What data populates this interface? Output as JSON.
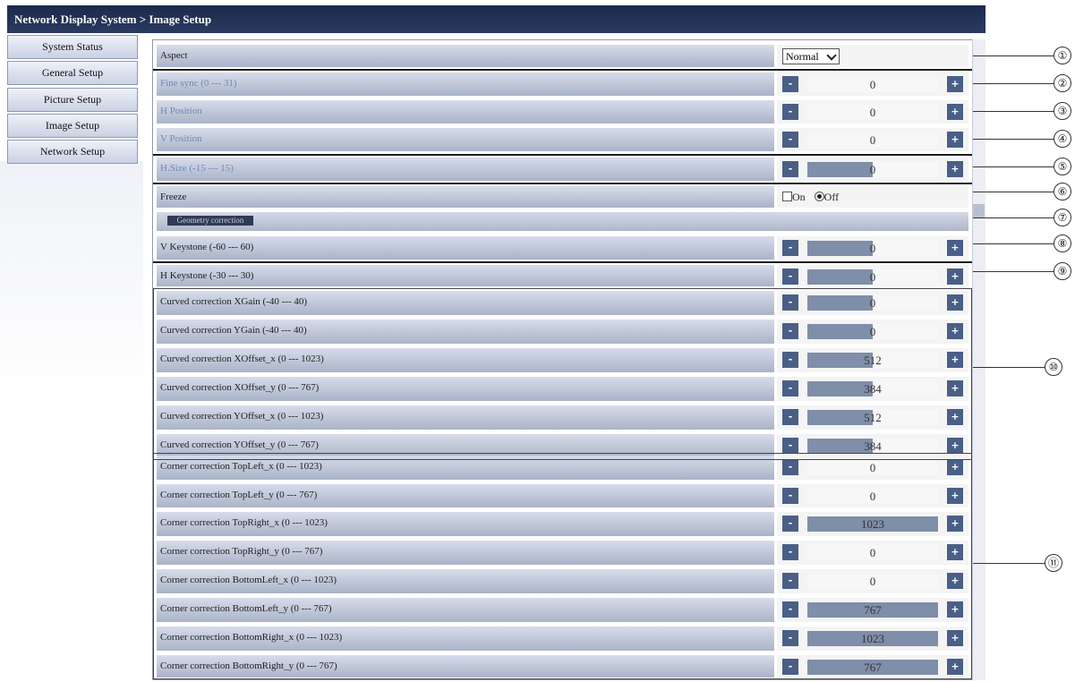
{
  "header": {
    "title": "Network Display System > Image Setup"
  },
  "sidebar": {
    "items": [
      {
        "label": "System Status"
      },
      {
        "label": "General Setup"
      },
      {
        "label": "Picture Setup"
      },
      {
        "label": "Image Setup"
      },
      {
        "label": "Network Setup"
      }
    ]
  },
  "settings": {
    "aspect": {
      "label": "Aspect",
      "value": "Normal"
    },
    "fine_sync": {
      "label": "Fine sync (0 --- 31)",
      "value": "0"
    },
    "h_position": {
      "label": "H Position",
      "value": "0"
    },
    "v_position": {
      "label": "V Position",
      "value": "0"
    },
    "h_size": {
      "label": "H.Size (-15 --- 15)",
      "value": "0",
      "level": 0.5
    },
    "freeze": {
      "label": "Freeze",
      "on_label": "On",
      "off_label": "Off",
      "selected": "Off"
    },
    "section_title": "Geometry correction",
    "v_keystone": {
      "label": "V Keystone (-60 --- 60)",
      "value": "0",
      "level": 0.5
    },
    "h_keystone": {
      "label": "H Keystone (-30 --- 30)",
      "value": "0",
      "level": 0.5
    },
    "curved": [
      {
        "label": "Curved correction XGain (-40 --- 40)",
        "value": "0",
        "level": 0.5
      },
      {
        "label": "Curved correction YGain (-40 --- 40)",
        "value": "0",
        "level": 0.5
      },
      {
        "label": "Curved correction XOffset_x (0 --- 1023)",
        "value": "512",
        "level": 0.5
      },
      {
        "label": "Curved correction XOffset_y (0 --- 767)",
        "value": "384",
        "level": 0.5
      },
      {
        "label": "Curved correction YOffset_x (0 --- 1023)",
        "value": "512",
        "level": 0.5
      },
      {
        "label": "Curved correction YOffset_y (0 --- 767)",
        "value": "384",
        "level": 0.5
      }
    ],
    "corner": [
      {
        "label": "Corner correction TopLeft_x (0 --- 1023)",
        "value": "0",
        "level": 0
      },
      {
        "label": "Corner correction TopLeft_y (0 --- 767)",
        "value": "0",
        "level": 0
      },
      {
        "label": "Corner correction TopRight_x (0 --- 1023)",
        "value": "1023",
        "level": 1
      },
      {
        "label": "Corner correction TopRight_y (0 --- 767)",
        "value": "0",
        "level": 0
      },
      {
        "label": "Corner correction BottomLeft_x (0 --- 1023)",
        "value": "0",
        "level": 0
      },
      {
        "label": "Corner correction BottomLeft_y (0 --- 767)",
        "value": "767",
        "level": 1
      },
      {
        "label": "Corner correction BottomRight_x (0 --- 1023)",
        "value": "1023",
        "level": 1
      },
      {
        "label": "Corner correction BottomRight_y (0 --- 767)",
        "value": "767",
        "level": 1
      }
    ]
  },
  "buttons": {
    "minus": "-",
    "plus": "+"
  },
  "callouts": [
    "①",
    "②",
    "③",
    "④",
    "⑤",
    "⑥",
    "⑦",
    "⑧",
    "⑨",
    "⑩",
    "⑪"
  ],
  "colors": {
    "titlebar": "#1b2a4d",
    "button": "#4a5f86",
    "slider_fill": "#7f8ea9",
    "disabled_text": "#6d8ab9"
  }
}
